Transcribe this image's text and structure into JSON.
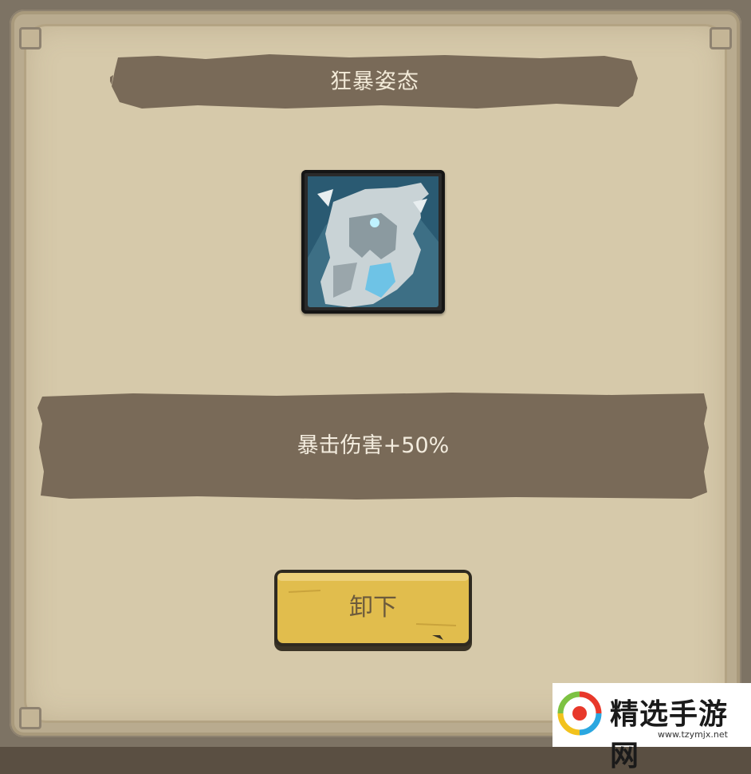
{
  "dialog": {
    "title": "狂暴姿态",
    "skill_icon": "berserker-portrait-icon",
    "description": "暴击伤害+50%",
    "button_label": "卸下"
  },
  "watermark": {
    "name": "精选手游网",
    "url": "www.tzymjx.net"
  },
  "colors": {
    "panel": "#d6c9aa",
    "ribbon": "#796a58",
    "button": "#e1bd4d",
    "text_light": "#f2ead8"
  }
}
